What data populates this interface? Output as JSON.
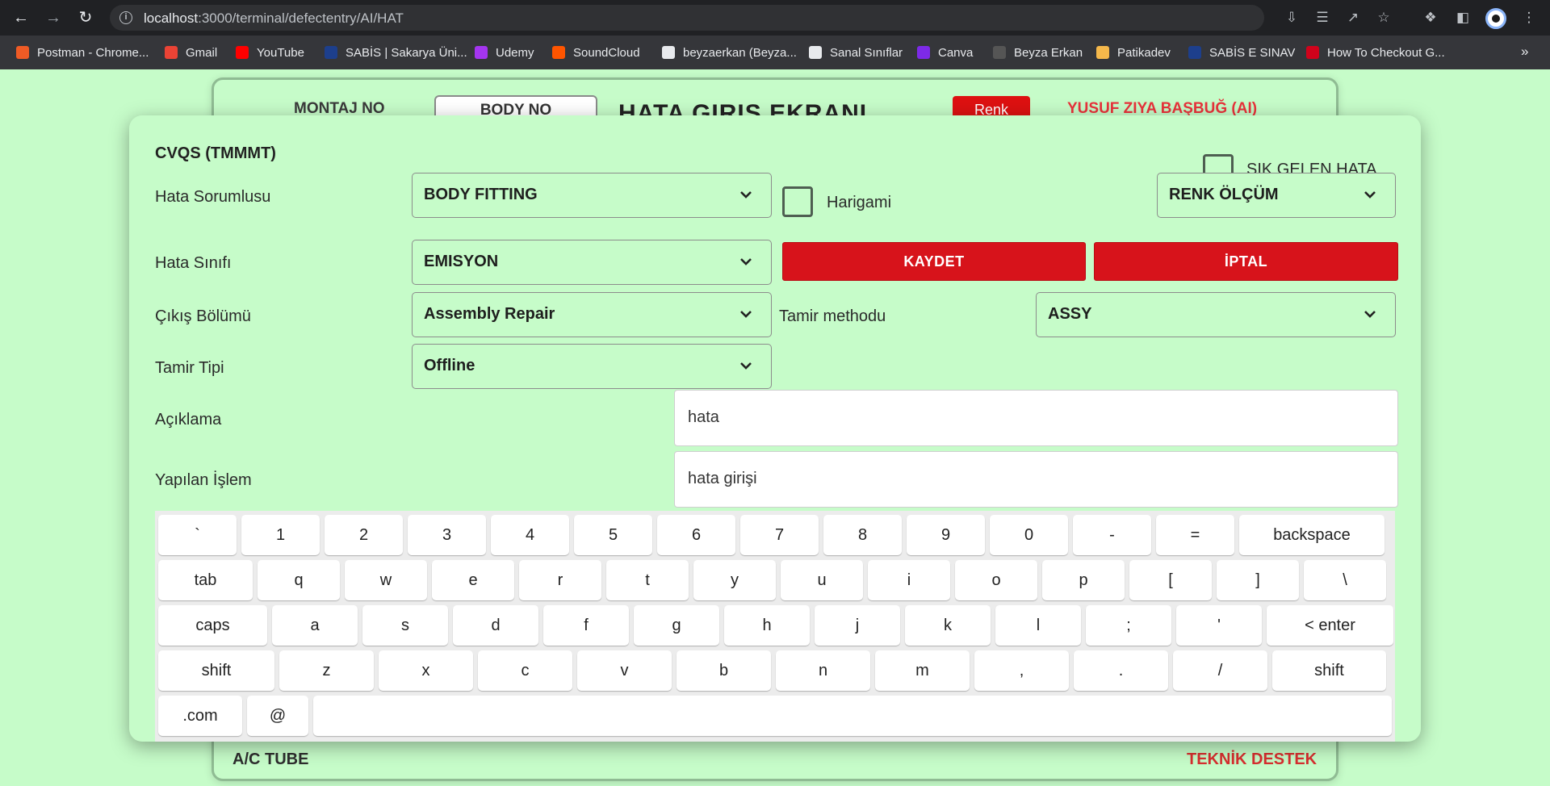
{
  "browser": {
    "url_host": "localhost",
    "url_path": ":3000/terminal/defectentry/AI/HAT",
    "bookmarks": [
      {
        "label": "Postman - Chrome...",
        "color": "#ef5b25"
      },
      {
        "label": "Gmail",
        "color": "#ea4335"
      },
      {
        "label": "YouTube",
        "color": "#ff0000"
      },
      {
        "label": "SABİS | Sakarya Üni...",
        "color": "#1d3f8c"
      },
      {
        "label": "Udemy",
        "color": "#a435f0"
      },
      {
        "label": "SoundCloud",
        "color": "#ff5500"
      },
      {
        "label": "beyzaerkan (Beyza...",
        "color": "#e8eaed"
      },
      {
        "label": "Sanal Sınıflar",
        "color": "#e8eaed"
      },
      {
        "label": "Canva",
        "color": "#7d2ae8"
      },
      {
        "label": "Beyza Erkan",
        "color": "#555555"
      },
      {
        "label": "Patikadev",
        "color": "#f5b84b"
      },
      {
        "label": "SABİS E SINAV",
        "color": "#1d3f8c"
      },
      {
        "label": "How To Checkout G...",
        "color": "#d0021b"
      }
    ],
    "more": "»"
  },
  "background_page": {
    "montaj_label": "MONTAJ NO",
    "body_no_label": "BODY NO",
    "title": "HATA GIRIS EKRANI",
    "renk_button": "Renk",
    "user": "YUSUF ZIYA BAŞBUĞ (AI)",
    "footer_left": "A/C TUBE",
    "footer_right": "TEKNİK DESTEK"
  },
  "modal": {
    "title": "CVQS (TMMMT)",
    "hata_sorumlusu": {
      "label": "Hata Sorumlusu",
      "value": "BODY FITTING"
    },
    "harigami": {
      "label": "Harigami",
      "checked": false
    },
    "sik_gelen_hata": {
      "label": "SIK GELEN HATA",
      "checked": false
    },
    "renk_olcum": {
      "value": "RENK ÖLÇÜM"
    },
    "hata_sinifi": {
      "label": "Hata Sınıfı",
      "value": "EMISYON"
    },
    "kaydet": "KAYDET",
    "iptal": "İPTAL",
    "cikis_bolumu": {
      "label": "Çıkış Bölümü",
      "value": "Assembly Repair"
    },
    "tamir_methodu": {
      "label": "Tamir methodu",
      "value": "ASSY"
    },
    "tamir_tipi": {
      "label": "Tamir Tipi",
      "value": "Offline"
    },
    "aciklama": {
      "label": "Açıklama",
      "value": "hata"
    },
    "yapilan_islem": {
      "label": "Yapılan İşlem",
      "value": "hata girişi"
    }
  },
  "keyboard": {
    "rows": [
      [
        "`",
        "1",
        "2",
        "3",
        "4",
        "5",
        "6",
        "7",
        "8",
        "9",
        "0",
        "-",
        "=",
        "backspace"
      ],
      [
        "tab",
        "q",
        "w",
        "e",
        "r",
        "t",
        "y",
        "u",
        "i",
        "o",
        "p",
        "[",
        "]",
        "\\"
      ],
      [
        "caps",
        "a",
        "s",
        "d",
        "f",
        "g",
        "h",
        "j",
        "k",
        "l",
        ";",
        "'",
        "< enter"
      ],
      [
        "shift",
        "z",
        "x",
        "c",
        "v",
        "b",
        "n",
        "m",
        ",",
        ".",
        "/",
        "shift"
      ],
      [
        ".com",
        "@",
        ""
      ]
    ]
  }
}
